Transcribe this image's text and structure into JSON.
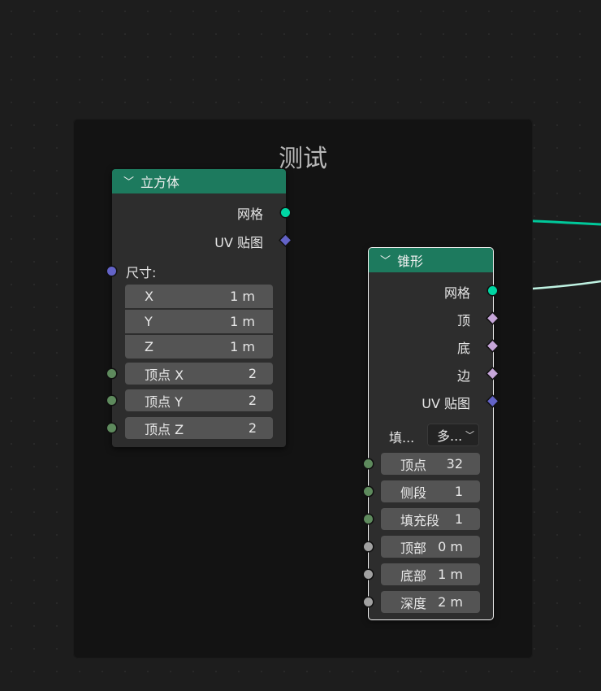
{
  "frame": {
    "title": "测试"
  },
  "cube_node": {
    "title": "立方体",
    "outputs": {
      "mesh": "网格",
      "uv_map": "UV 贴图"
    },
    "size_label": "尺寸:",
    "size": [
      {
        "axis": "X",
        "value": "1 m"
      },
      {
        "axis": "Y",
        "value": "1 m"
      },
      {
        "axis": "Z",
        "value": "1 m"
      }
    ],
    "vertices": [
      {
        "label": "顶点 X",
        "value": "2"
      },
      {
        "label": "顶点 Y",
        "value": "2"
      },
      {
        "label": "顶点 Z",
        "value": "2"
      }
    ]
  },
  "cone_node": {
    "title": "锥形",
    "outputs": {
      "mesh": "网格",
      "top": "顶",
      "bottom": "底",
      "side": "边",
      "uv_map": "UV 贴图"
    },
    "fill_label": "填...",
    "fill_value": "多...",
    "fields": [
      {
        "label": "顶点",
        "value": "32"
      },
      {
        "label": "侧段",
        "value": "1"
      },
      {
        "label": "填充段",
        "value": "1"
      },
      {
        "label": "顶部",
        "value": "0 m"
      },
      {
        "label": "底部",
        "value": "1 m"
      },
      {
        "label": "深度",
        "value": "2 m"
      }
    ]
  },
  "colors": {
    "header": "#1d7a5e",
    "geometry_socket": "#00d6a3",
    "vector_socket": "#6363c7",
    "int_socket": "#5e8a5d",
    "float_socket": "#a1a1a1"
  }
}
